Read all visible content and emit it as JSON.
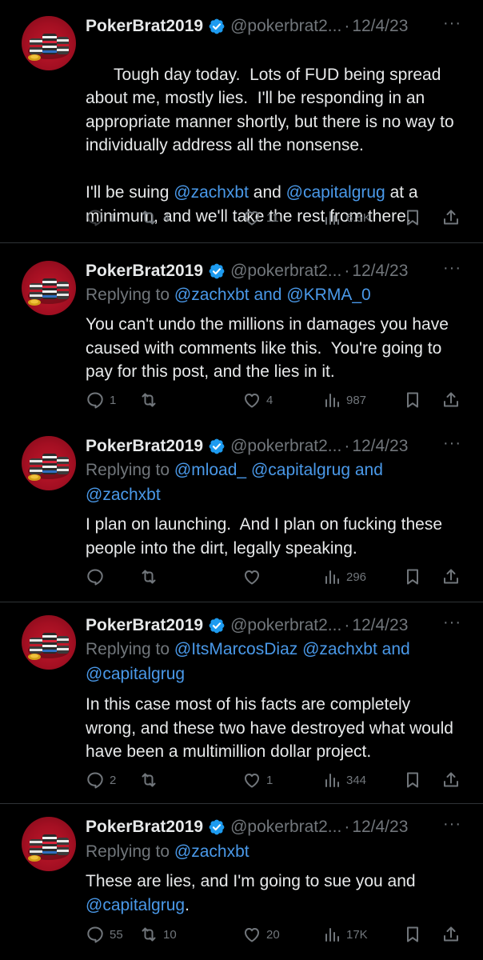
{
  "user": {
    "name": "PokerBrat2019",
    "handle": "@pokerbrat2...",
    "separator": "·",
    "date": "12/4/23",
    "more": "···",
    "replying_prefix": "Replying to"
  },
  "tweets": [
    {
      "body_parts": [
        "Tough day today.  Lots of FUD being spread about me, mostly lies.  I'll be responding in an appropriate manner shortly, but there is no way to individually address all the nonsense.\n\nI'll be suing ",
        "@zachxbt",
        " and ",
        "@capitalgrug",
        " at a minimum, and we'll take the rest from there."
      ],
      "replies": "1",
      "reposts": "4",
      "likes": "11",
      "views": "6.5K"
    },
    {
      "replying_to": [
        "@zachxbt",
        "and",
        "@KRMA_0"
      ],
      "body": "You can't undo the millions in damages you have caused with comments like this.  You're going to pay for this post, and the lies in it.",
      "replies": "1",
      "reposts": "",
      "likes": "4",
      "views": "987"
    },
    {
      "replying_to": [
        "@mload_",
        "@capitalgrug",
        "and",
        "@zachxbt"
      ],
      "body": "I plan on launching.  And I plan on fucking these people into the dirt, legally speaking.",
      "replies": "",
      "reposts": "",
      "likes": "",
      "views": "296"
    },
    {
      "replying_to": [
        "@ItsMarcosDiaz",
        "@zachxbt",
        "and",
        "@capitalgrug"
      ],
      "body": "In this case most of his facts are completely wrong, and these two have destroyed what would have been a multimillion dollar project.",
      "replies": "2",
      "reposts": "",
      "likes": "1",
      "views": "344"
    },
    {
      "replying_to": [
        "@zachxbt"
      ],
      "body_parts": [
        "These are lies, and I'm going to sue you and ",
        "@capitalgrug",
        "."
      ],
      "replies": "55",
      "reposts": "10",
      "likes": "20",
      "views": "17K"
    }
  ],
  "colors": {
    "background": "#000000",
    "text": "#e7e9ea",
    "muted": "#71767b",
    "link": "#4a99e9",
    "verified": "#1d9bf0",
    "divider": "#2f3336"
  },
  "icons": [
    "verified-badge-icon",
    "reply-icon",
    "repost-icon",
    "like-icon",
    "views-icon",
    "bookmark-icon",
    "share-icon",
    "more-icon"
  ]
}
